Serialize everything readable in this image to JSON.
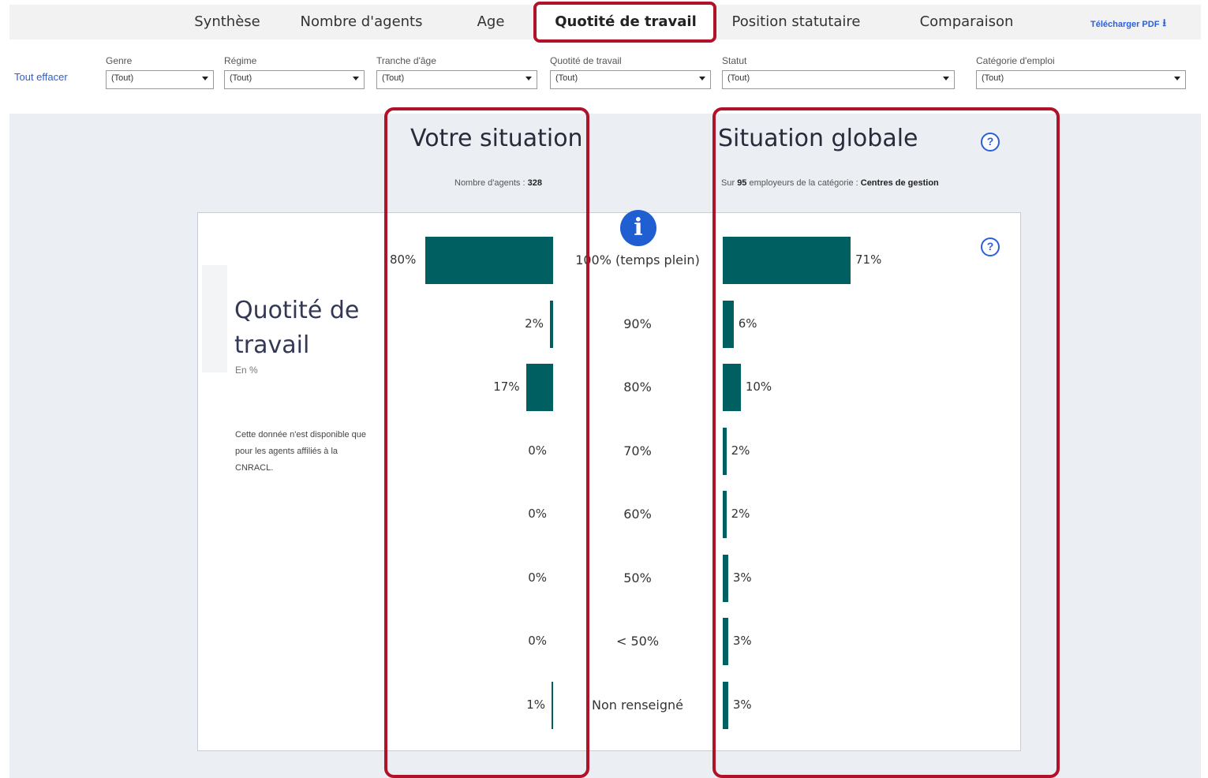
{
  "tabs": [
    {
      "label": "Synthèse"
    },
    {
      "label": "Nombre d'agents"
    },
    {
      "label": "Age"
    },
    {
      "label": "Quotité de travail"
    },
    {
      "label": "Position statutaire"
    },
    {
      "label": "Comparaison"
    }
  ],
  "download_pdf": "Télécharger PDF",
  "clear_all": "Tout effacer",
  "filters": [
    {
      "label": "Genre",
      "value": "(Tout)"
    },
    {
      "label": "Régime",
      "value": "(Tout)"
    },
    {
      "label": "Tranche d'âge",
      "value": "(Tout)"
    },
    {
      "label": "Quotité de travail",
      "value": "(Tout)"
    },
    {
      "label": "Statut",
      "value": "(Tout)"
    },
    {
      "label": "Catégorie d'emploi",
      "value": "(Tout)"
    }
  ],
  "left": {
    "title": "Votre situation",
    "subtitle_prefix": "Nombre d'agents : ",
    "subtitle_value": "328"
  },
  "right": {
    "title": "Situation globale",
    "subtitle_prefix": "Sur ",
    "subtitle_count": "95",
    "subtitle_mid": " employeurs de la catégorie : ",
    "subtitle_category": "Centres de gestion"
  },
  "panel": {
    "title": "Quotité de travail",
    "unit": "En %",
    "note": "Cette donnée n'est disponible que pour les agents affiliés à la CNRACL."
  },
  "chart_data": {
    "type": "bar",
    "categories": [
      "100% (temps plein)",
      "90%",
      "80%",
      "70%",
      "60%",
      "50%",
      "< 50%",
      "Non renseigné"
    ],
    "series": [
      {
        "name": "Votre situation",
        "values": [
          80,
          2,
          17,
          0,
          0,
          0,
          0,
          1
        ],
        "labels": [
          "80%",
          "2%",
          "17%",
          "0%",
          "0%",
          "0%",
          "0%",
          "1%"
        ]
      },
      {
        "name": "Situation globale",
        "values": [
          71,
          6,
          10,
          2,
          2,
          3,
          3,
          3
        ],
        "labels": [
          "71%",
          "6%",
          "10%",
          "2%",
          "2%",
          "3%",
          "3%",
          "3%"
        ]
      }
    ],
    "color": "#005f60"
  },
  "colors": {
    "accent": "#005f60",
    "highlight": "#b0122a",
    "link": "#2b5fd9"
  }
}
